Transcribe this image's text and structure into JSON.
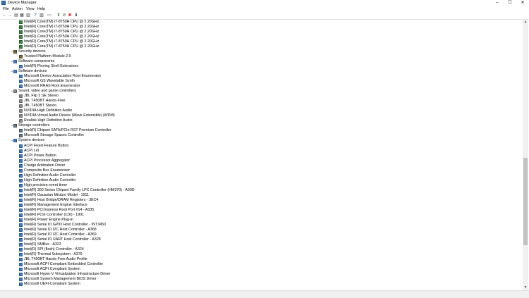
{
  "window": {
    "title": "Device Manager",
    "minimize": "–",
    "maximize": "☐",
    "close": "✕"
  },
  "menu": [
    "File",
    "Action",
    "View",
    "Help"
  ],
  "toolbar": [
    {
      "name": "back-icon",
      "glyph": "←"
    },
    {
      "name": "forward-icon",
      "glyph": "→"
    },
    {
      "name": "properties-icon",
      "glyph": "▤"
    },
    {
      "name": "show-hide-icon",
      "glyph": "▦"
    },
    {
      "name": "tree-icon",
      "glyph": "▥"
    },
    {
      "name": "help-icon",
      "glyph": "?"
    },
    {
      "name": "details-icon",
      "glyph": "▧"
    },
    {
      "name": "monitor-icon",
      "glyph": "▭"
    },
    {
      "name": "update-driver-icon",
      "glyph": "⬆"
    },
    {
      "name": "disable-icon",
      "glyph": "⊘"
    },
    {
      "name": "uninstall-icon",
      "glyph": "✖"
    },
    {
      "name": "scan-icon",
      "glyph": "⬇"
    }
  ],
  "tree": [
    {
      "level": 2,
      "icon": "cpu",
      "text": "Intel(R) Core(TM) i7-8750H CPU @ 2.20GHz"
    },
    {
      "level": 2,
      "icon": "cpu",
      "text": "Intel(R) Core(TM) i7-8750H CPU @ 2.20GHz"
    },
    {
      "level": 2,
      "icon": "cpu",
      "text": "Intel(R) Core(TM) i7-8750H CPU @ 2.20GHz"
    },
    {
      "level": 2,
      "icon": "cpu",
      "text": "Intel(R) Core(TM) i7-8750H CPU @ 2.20GHz"
    },
    {
      "level": 2,
      "icon": "cpu",
      "text": "Intel(R) Core(TM) i7-8750H CPU @ 2.20GHz"
    },
    {
      "level": 2,
      "icon": "cpu",
      "text": "Intel(R) Core(TM) i7-8750H CPU @ 2.20GHz"
    },
    {
      "level": 1,
      "icon": "sec",
      "text": "Security devices",
      "exp": "⌄"
    },
    {
      "level": 2,
      "icon": "sec",
      "text": "Trusted Platform Module 2.0"
    },
    {
      "level": 1,
      "icon": "comp",
      "text": "Software components",
      "exp": "⌄"
    },
    {
      "level": 2,
      "icon": "comp",
      "text": "Intel(R) Pinning Shell Extensions"
    },
    {
      "level": 1,
      "icon": "comp",
      "text": "Software devices",
      "exp": "⌄"
    },
    {
      "level": 2,
      "icon": "comp",
      "text": "Microsoft Device Association Root Enumerator"
    },
    {
      "level": 2,
      "icon": "comp",
      "text": "Microsoft GS Wavetable Synth"
    },
    {
      "level": 2,
      "icon": "comp",
      "text": "Microsoft RRAS Root Enumerator"
    },
    {
      "level": 1,
      "icon": "sound",
      "text": "Sound, video and game controllers",
      "exp": "⌄"
    },
    {
      "level": 2,
      "icon": "sound",
      "text": "JBL Flip 3 SE Stereo"
    },
    {
      "level": 2,
      "icon": "sound",
      "text": "JBL T450BT Hands-Free"
    },
    {
      "level": 2,
      "icon": "sound",
      "text": "JBL T450BT Stereo"
    },
    {
      "level": 2,
      "icon": "sound",
      "text": "NVIDIA High Definition Audio"
    },
    {
      "level": 2,
      "icon": "sound",
      "text": "NVIDIA Virtual Audio Device (Wave Extensible) (WDM)"
    },
    {
      "level": 2,
      "icon": "sound",
      "text": "Realtek High Definition Audio"
    },
    {
      "level": 1,
      "icon": "store",
      "text": "Storage controllers",
      "exp": "⌄"
    },
    {
      "level": 2,
      "icon": "store",
      "text": "Intel(R) Chipset SATA/PCIe RST Premium Controller"
    },
    {
      "level": 2,
      "icon": "store",
      "text": "Microsoft Storage Spaces Controller"
    },
    {
      "level": 1,
      "icon": "sys",
      "text": "System devices",
      "exp": "⌄"
    },
    {
      "level": 2,
      "icon": "sys",
      "text": "ACPI Fixed Feature Button"
    },
    {
      "level": 2,
      "icon": "sys",
      "text": "ACPI Lid"
    },
    {
      "level": 2,
      "icon": "sys",
      "text": "ACPI Power Button"
    },
    {
      "level": 2,
      "icon": "sys",
      "text": "ACPI Processor Aggregator"
    },
    {
      "level": 2,
      "icon": "sys",
      "text": "Charge Arbitration Driver"
    },
    {
      "level": 2,
      "icon": "sys",
      "text": "Composite Bus Enumerator"
    },
    {
      "level": 2,
      "icon": "sys",
      "text": "High Definition Audio Controller"
    },
    {
      "level": 2,
      "icon": "sys",
      "text": "High Definition Audio Controller"
    },
    {
      "level": 2,
      "icon": "sys",
      "text": "High precision event timer"
    },
    {
      "level": 2,
      "icon": "sys",
      "text": "Intel(R) 300 Series Chipset Family LPC Controller (HM370) - A30D"
    },
    {
      "level": 2,
      "icon": "sys",
      "text": "Intel(R) Gaussian Mixture Model - 1911"
    },
    {
      "level": 2,
      "icon": "sys",
      "text": "Intel(R) Host Bridge/DRAM Registers - 3EC4"
    },
    {
      "level": 2,
      "icon": "sys",
      "text": "Intel(R) Management Engine Interface"
    },
    {
      "level": 2,
      "icon": "sys",
      "text": "Intel(R) PCI Express Root Port #14 - A335"
    },
    {
      "level": 2,
      "icon": "sys",
      "text": "Intel(R) PCIe Controller (x16) - 1901"
    },
    {
      "level": 2,
      "icon": "sys",
      "text": "Intel(R) Power Engine Plug-in"
    },
    {
      "level": 2,
      "icon": "sys",
      "text": "Intel(R) Serial IO GPIO Host Controller - INT3450"
    },
    {
      "level": 2,
      "icon": "sys",
      "text": "Intel(R) Serial IO I2C Host Controller - A368"
    },
    {
      "level": 2,
      "icon": "sys",
      "text": "Intel(R) Serial IO I2C Host Controller - A369"
    },
    {
      "level": 2,
      "icon": "sys",
      "text": "Intel(R) Serial IO UART Host Controller - A328"
    },
    {
      "level": 2,
      "icon": "sys",
      "text": "Intel(R) SMBus - A323"
    },
    {
      "level": 2,
      "icon": "sys",
      "text": "Intel(R) SPI (flash) Controller - A324"
    },
    {
      "level": 2,
      "icon": "sys",
      "text": "Intel(R) Thermal Subsystem - A379"
    },
    {
      "level": 2,
      "icon": "sys",
      "text": "JBL T450BT Hands-Free Audio Profile"
    },
    {
      "level": 2,
      "icon": "sys",
      "text": "Microsoft ACPI-Compliant Embedded Controller"
    },
    {
      "level": 2,
      "icon": "sys",
      "text": "Microsoft ACPI-Compliant System"
    },
    {
      "level": 2,
      "icon": "sys",
      "text": "Microsoft Hyper-V Virtualization Infrastructure Driver"
    },
    {
      "level": 2,
      "icon": "sys",
      "text": "Microsoft System Management BIOS Driver"
    },
    {
      "level": 2,
      "icon": "sys",
      "text": "Microsoft UEFI-Compliant System"
    }
  ],
  "scrollbar": {
    "up": "▲",
    "down": "▼"
  }
}
